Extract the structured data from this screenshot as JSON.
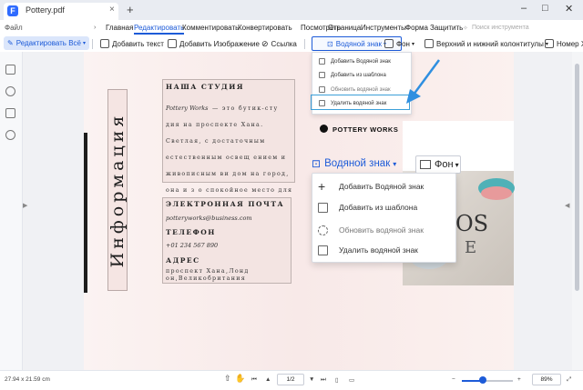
{
  "app": {
    "tab_title": "Pottery.pdf",
    "close_tab": "×",
    "new_tab": "+",
    "window_controls": [
      "–",
      "□",
      "✕"
    ]
  },
  "menu": {
    "file": "Файл",
    "items": [
      "Главная",
      "Редактировать",
      "Комментировать",
      "Конвертировать",
      "Посмотреть",
      "Страница",
      "Инструменты",
      "Форма",
      "Защитить"
    ],
    "active": "Редактировать",
    "search_tools": "Поиск инструмента"
  },
  "toolbar": {
    "edit_all": "Редактировать Всё",
    "add_text": "Добавить текст",
    "add_image": "Добавить Изображение",
    "link": "Ссылка",
    "watermark": "Водяной знак",
    "background": "Фон",
    "header_footer": "Верхний и нижний колонтитулы",
    "bates": "Номер Х"
  },
  "watermark_menu": {
    "items": [
      "Добавить Водяной знак",
      "Добавить из шаблона",
      "Обновить водяной знак",
      "Удалить водяной знак"
    ],
    "highlighted": "Удалить водяной знак"
  },
  "document": {
    "vertical_title": "Информация",
    "studio_heading": "НАША СТУДИЯ",
    "studio_name": "Pottery Works",
    "studio_text": "— это бутик-сту дия на проспекте Хана. Светлая, с достаточным естественным освещ ением и живописным ви дом на город, она и з о спокойное место для р аботы, пространств о, которое предлагает ы ежедневно и позволяет развиваться в вашей практике.",
    "email_heading": "ЭЛЕКТРОННАЯ ПОЧТА",
    "email": "potteryworks@business.com",
    "phone_heading": "ТЕЛЕФОН",
    "phone": "+01 234 567 890",
    "address_heading": "АДРЕС",
    "address": "проспект Хана,Лонд он,Великобритания",
    "brand": "POTTERY WORKS",
    "photo_letters_1": "OS",
    "photo_letters_2": "E"
  },
  "zoomed": {
    "watermark_label": "Водяной знак",
    "background_label": "Фон",
    "items": [
      "Добавить Водяной знак",
      "Добавить из шаблона",
      "Обновить водяной знак",
      "Удалить водяной знак"
    ]
  },
  "status": {
    "dimensions": "27.94 x 21.59 cm",
    "page": "1/2",
    "zoom": "89%"
  },
  "colors": {
    "accent": "#1d5bd8",
    "highlight_border": "#3b9fd8",
    "arrow": "#2f8fe0"
  }
}
